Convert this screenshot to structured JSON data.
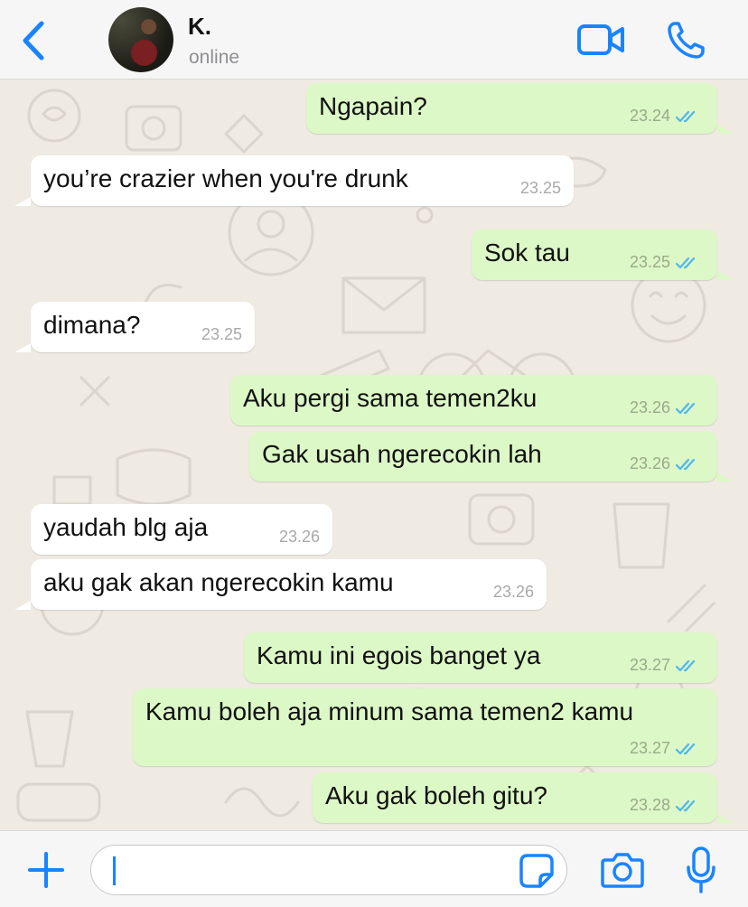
{
  "header": {
    "contact_name": "K.",
    "status": "online"
  },
  "messages": [
    {
      "direction": "out",
      "text": "Ngapain?",
      "time": "23.24",
      "read": true
    },
    {
      "direction": "in",
      "text": "you’re crazier when you're drunk",
      "time": "23.25"
    },
    {
      "direction": "out",
      "text": "Sok tau",
      "time": "23.25",
      "read": true
    },
    {
      "direction": "in",
      "text": "dimana?",
      "time": "23.25"
    },
    {
      "direction": "out",
      "text": "Aku pergi sama temen2ku",
      "time": "23.26",
      "read": true
    },
    {
      "direction": "out",
      "text": "Gak usah ngerecokin lah",
      "time": "23.26",
      "read": true
    },
    {
      "direction": "in",
      "text": "yaudah blg aja",
      "time": "23.26"
    },
    {
      "direction": "in",
      "text": "aku gak akan ngerecokin kamu",
      "time": "23.26"
    },
    {
      "direction": "out",
      "text": "Kamu ini egois banget ya",
      "time": "23.27",
      "read": true
    },
    {
      "direction": "out",
      "text": "Kamu boleh aja minum sama temen2 kamu",
      "time": "23.27",
      "read": true
    },
    {
      "direction": "out",
      "text": "Aku gak boleh gitu?",
      "time": "23.28",
      "read": true
    }
  ],
  "input": {
    "value": "",
    "placeholder": ""
  },
  "icons": {
    "back": "chevron-left-icon",
    "video": "video-camera-icon",
    "call": "phone-icon",
    "attach": "plus-icon",
    "sticker": "sticker-icon",
    "camera": "camera-icon",
    "mic": "microphone-icon",
    "read": "double-check-icon"
  },
  "colors": {
    "accent": "#1a84ff",
    "outgoing_bubble": "#dcf8c6",
    "incoming_bubble": "#ffffff",
    "chat_background": "#efeae2",
    "read_ticks": "#4fb6ec"
  }
}
